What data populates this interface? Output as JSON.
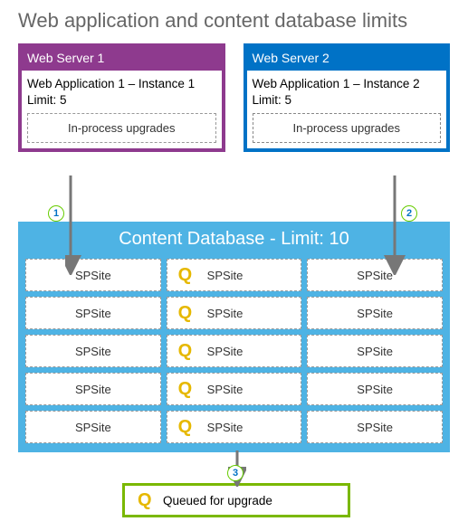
{
  "title": "Web application and content database limits",
  "servers": [
    {
      "header": "Web Server 1",
      "app": "Web Application 1 – Instance 1",
      "limit": "Limit: 5",
      "proc": "In-process upgrades"
    },
    {
      "header": "Web Server 2",
      "app": "Web Application 1 – Instance 2",
      "limit": "Limit: 5",
      "proc": "In-process upgrades"
    }
  ],
  "steps": [
    "1",
    "2",
    "3"
  ],
  "db": {
    "header": "Content Database - Limit: 10",
    "cells": [
      {
        "t": "SPSite",
        "q": false
      },
      {
        "t": "SPSite",
        "q": true
      },
      {
        "t": "SPSite",
        "q": false
      },
      {
        "t": "SPSite",
        "q": false
      },
      {
        "t": "SPSite",
        "q": true
      },
      {
        "t": "SPSite",
        "q": false
      },
      {
        "t": "SPSite",
        "q": false
      },
      {
        "t": "SPSite",
        "q": true
      },
      {
        "t": "SPSite",
        "q": false
      },
      {
        "t": "SPSite",
        "q": false
      },
      {
        "t": "SPSite",
        "q": true
      },
      {
        "t": "SPSite",
        "q": false
      },
      {
        "t": "SPSite",
        "q": false
      },
      {
        "t": "SPSite",
        "q": true
      },
      {
        "t": "SPSite",
        "q": false
      }
    ]
  },
  "legend": "Queued for upgrade"
}
